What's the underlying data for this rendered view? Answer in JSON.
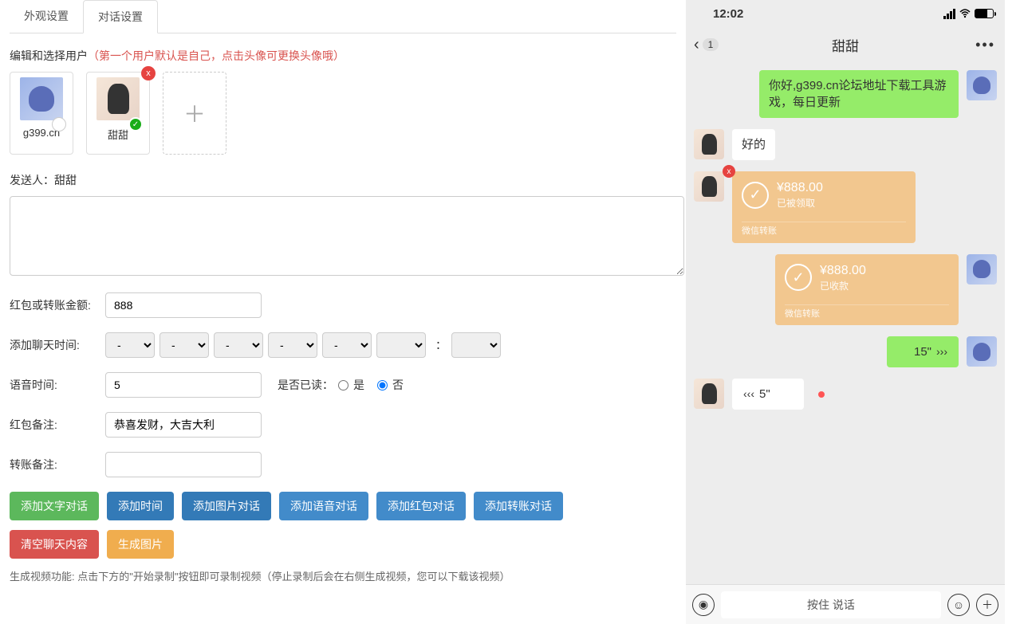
{
  "tabs": {
    "appearance": "外观设置",
    "dialog": "对话设置"
  },
  "editor": {
    "title_prefix": "编辑和选择用户",
    "title_hint": "（第一个用户默认是自己，点击头像可更换头像哦）",
    "users": [
      {
        "name": "g399.cn"
      },
      {
        "name": "甜甜"
      }
    ],
    "add_icon": "＋"
  },
  "form": {
    "sender_label": "发送人：",
    "sender_name": "甜甜",
    "amount_label": "红包或转账金额:",
    "amount_value": "888",
    "time_label": "添加聊天时间:",
    "dash": "-",
    "colon": "：",
    "voice_label": "语音时间:",
    "voice_value": "5",
    "read_label": "是否已读：",
    "read_yes": "是",
    "read_no": "否",
    "redpack_note_label": "红包备注:",
    "redpack_note_value": "恭喜发财，大吉大利",
    "transfer_note_label": "转账备注:",
    "transfer_note_value": ""
  },
  "buttons": {
    "add_text": "添加文字对话",
    "add_time": "添加时间",
    "add_image": "添加图片对话",
    "add_voice": "添加语音对话",
    "add_redpack": "添加红包对话",
    "add_transfer": "添加转账对话",
    "clear": "清空聊天内容",
    "gen_image": "生成图片"
  },
  "footnote": "生成视频功能: 点击下方的\"开始录制\"按钮即可录制视频（停止录制后会在右侧生成视频，您可以下载该视频）",
  "phone": {
    "time": "12:02",
    "back_badge": "1",
    "title": "甜甜",
    "more": "•••",
    "input_hold": "按住 说话",
    "messages": [
      {
        "side": "right",
        "type": "text",
        "text": "你好,g399.cn论坛地址下载工具游戏，每日更新"
      },
      {
        "side": "left",
        "type": "text",
        "text": "好的"
      },
      {
        "side": "left",
        "type": "transfer",
        "amount": "¥888.00",
        "status": "已被领取",
        "footer": "微信转账",
        "deletable": true
      },
      {
        "side": "right",
        "type": "transfer",
        "amount": "¥888.00",
        "status": "已收款",
        "footer": "微信转账"
      },
      {
        "side": "right",
        "type": "voice",
        "duration": "15\""
      },
      {
        "side": "left",
        "type": "voice",
        "duration": "5\"",
        "unread": true
      }
    ]
  }
}
